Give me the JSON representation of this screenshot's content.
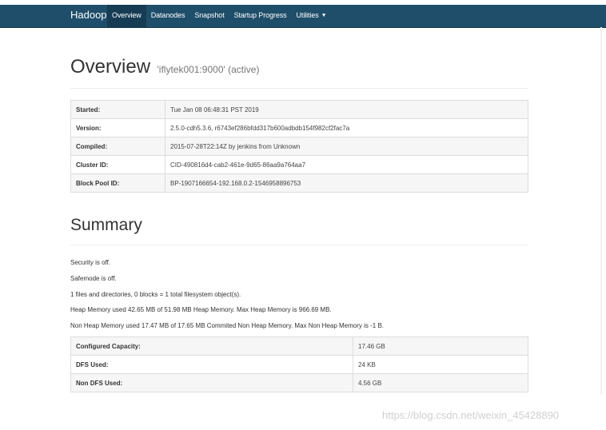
{
  "navbar": {
    "brand": "Hadoop",
    "items": [
      {
        "label": "Overview",
        "active": true
      },
      {
        "label": "Datanodes",
        "active": false
      },
      {
        "label": "Snapshot",
        "active": false
      },
      {
        "label": "Startup Progress",
        "active": false
      },
      {
        "label": "Utilities",
        "active": false,
        "dropdown": true
      }
    ],
    "bar_color": "#1f4e6a"
  },
  "overview": {
    "title": "Overview",
    "subtitle": "'iflytek001:9000' (active)",
    "rows": [
      {
        "key": "Started:",
        "value": "Tue Jan 08 06:48:31 PST 2019"
      },
      {
        "key": "Version:",
        "value": "2.5.0-cdh5.3.6, r6743ef286bfdd317b600adbdb154f982cf2fac7a"
      },
      {
        "key": "Compiled:",
        "value": "2015-07-28T22:14Z by jenkins from Unknown"
      },
      {
        "key": "Cluster ID:",
        "value": "CID-490816d4-cab2-461e-9d65-86aa9a764aa7"
      },
      {
        "key": "Block Pool ID:",
        "value": "BP-1907166654-192.168.0.2-1546958896753"
      }
    ]
  },
  "summary": {
    "title": "Summary",
    "lines": [
      "Security is off.",
      "Safemode is off.",
      "1 files and directories, 0 blocks = 1 total filesystem object(s).",
      "Heap Memory used 42.65 MB of 51.98 MB Heap Memory. Max Heap Memory is 966.69 MB.",
      "Non Heap Memory used 17.47 MB of 17.65 MB Commited Non Heap Memory. Max Non Heap Memory is -1 B."
    ],
    "rows": [
      {
        "key": "Configured Capacity:",
        "value": "17.46 GB"
      },
      {
        "key": "DFS Used:",
        "value": "24 KB"
      },
      {
        "key": "Non DFS Used:",
        "value": "4.56 GB"
      }
    ]
  },
  "watermark": "https://blog.csdn.net/weixin_45428890"
}
